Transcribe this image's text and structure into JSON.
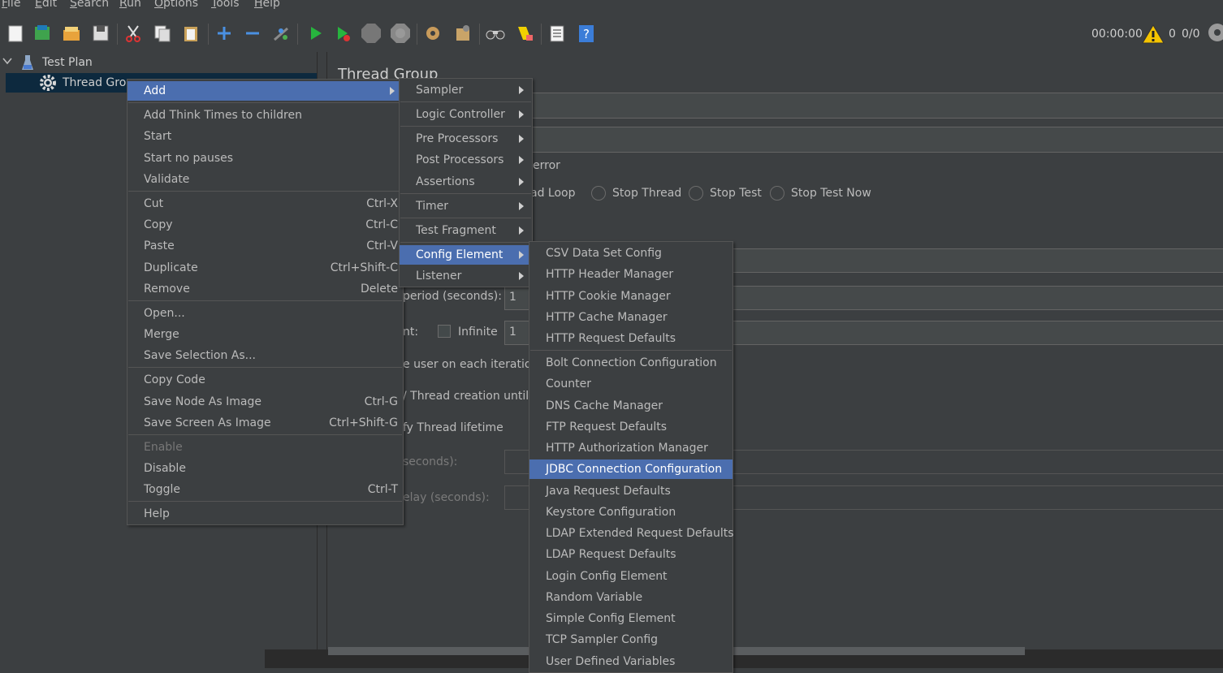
{
  "menubar": {
    "items": [
      {
        "mn": "F",
        "rest": "ile"
      },
      {
        "mn": "E",
        "rest": "dit"
      },
      {
        "mn": "S",
        "rest": "earch"
      },
      {
        "mn": "R",
        "rest": "un"
      },
      {
        "mn": "O",
        "rest": "ptions"
      },
      {
        "mn": "T",
        "rest": "ools"
      },
      {
        "mn": "H",
        "rest": "elp"
      }
    ]
  },
  "toolbar": {
    "timer": "00:00:00",
    "warning_count": "0",
    "thread_count": "0/0"
  },
  "tree": {
    "test_plan": "Test Plan",
    "thread_group": "Thread Grou"
  },
  "panel": {
    "title": "Thread Group",
    "error_label": "error",
    "loop_label": "ad Loop",
    "stop_thread": "Stop Thread",
    "stop_test": "Stop Test",
    "stop_test_now": "Stop Test Now",
    "period_label": "period (seconds):",
    "period_value": "1",
    "count_label": "nt:",
    "infinite": "Infinite",
    "loop_value": "1",
    "same_user": "e user on each iteration",
    "delay_creation": "/ Thread creation until n",
    "lifetime": "fy Thread lifetime",
    "duration": "seconds):",
    "startup_delay": "elay (seconds):"
  },
  "context_menu": {
    "add": "Add",
    "items": [
      {
        "label": "Add Think Times to children",
        "shortcut": ""
      },
      {
        "label": "Start",
        "shortcut": ""
      },
      {
        "label": "Start no pauses",
        "shortcut": ""
      },
      {
        "label": "Validate",
        "shortcut": ""
      },
      {
        "label": "Cut",
        "shortcut": "Ctrl-X"
      },
      {
        "label": "Copy",
        "shortcut": "Ctrl-C"
      },
      {
        "label": "Paste",
        "shortcut": "Ctrl-V"
      },
      {
        "label": "Duplicate",
        "shortcut": "Ctrl+Shift-C"
      },
      {
        "label": "Remove",
        "shortcut": "Delete"
      },
      {
        "label": "Open...",
        "shortcut": ""
      },
      {
        "label": "Merge",
        "shortcut": ""
      },
      {
        "label": "Save Selection As...",
        "shortcut": ""
      },
      {
        "label": "Copy Code",
        "shortcut": ""
      },
      {
        "label": "Save Node As Image",
        "shortcut": "Ctrl-G"
      },
      {
        "label": "Save Screen As Image",
        "shortcut": "Ctrl+Shift-G"
      },
      {
        "label": "Enable",
        "shortcut": ""
      },
      {
        "label": "Disable",
        "shortcut": ""
      },
      {
        "label": "Toggle",
        "shortcut": "Ctrl-T"
      },
      {
        "label": "Help",
        "shortcut": ""
      }
    ]
  },
  "add_submenu": {
    "items": [
      "Sampler",
      "Logic Controller",
      "Pre Processors",
      "Post Processors",
      "Assertions",
      "Timer",
      "Test Fragment",
      "Config Element",
      "Listener"
    ]
  },
  "config_submenu": {
    "items": [
      "CSV Data Set Config",
      "HTTP Header Manager",
      "HTTP Cookie Manager",
      "HTTP Cache Manager",
      "HTTP Request Defaults",
      "Bolt Connection Configuration",
      "Counter",
      "DNS Cache Manager",
      "FTP Request Defaults",
      "HTTP Authorization Manager",
      "JDBC Connection Configuration",
      "Java Request Defaults",
      "Keystore Configuration",
      "LDAP Extended Request Defaults",
      "LDAP Request Defaults",
      "Login Config Element",
      "Random Variable",
      "Simple Config Element",
      "TCP Sampler Config",
      "User Defined Variables"
    ]
  },
  "colors": {
    "background": "#3c3f41",
    "highlight": "#4b6eaf",
    "selected_tree_row": "#0d293e"
  }
}
